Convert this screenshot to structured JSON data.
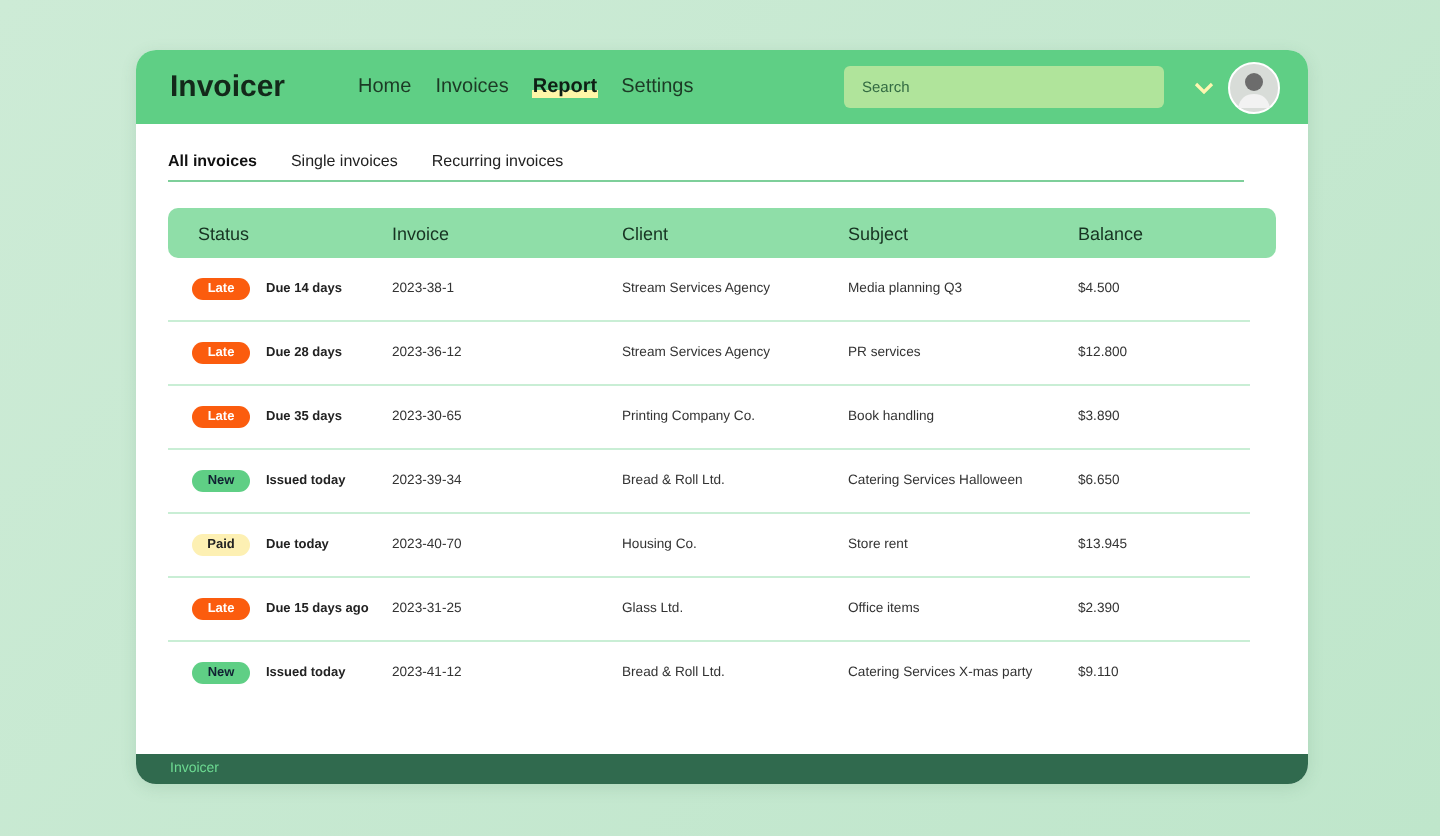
{
  "header": {
    "logo": "Invoicer",
    "nav": [
      {
        "label": "Home",
        "selected": false
      },
      {
        "label": "Invoices",
        "selected": false
      },
      {
        "label": "Report",
        "selected": true
      },
      {
        "label": "Settings",
        "selected": false
      }
    ],
    "search": {
      "placeholder": "Search"
    }
  },
  "tabs": [
    {
      "label": "All invoices",
      "selected": true
    },
    {
      "label": "Single invoices",
      "selected": false
    },
    {
      "label": "Recurring invoices",
      "selected": false
    }
  ],
  "table": {
    "columns": [
      "Status",
      "Invoice",
      "Client",
      "Subject",
      "Balance"
    ],
    "rows": [
      {
        "status": {
          "kind": "late",
          "label": "Late"
        },
        "due": "Due 14 days",
        "invoice": "2023-38-1",
        "client": "Stream Services Agency",
        "subject": "Media planning Q3",
        "balance": "$4.500"
      },
      {
        "status": {
          "kind": "late",
          "label": "Late"
        },
        "due": "Due 28 days",
        "invoice": "2023-36-12",
        "client": "Stream Services Agency",
        "subject": "PR services",
        "balance": "$12.800"
      },
      {
        "status": {
          "kind": "late",
          "label": "Late"
        },
        "due": "Due 35 days",
        "invoice": "2023-30-65",
        "client": "Printing Company Co.",
        "subject": "Book handling",
        "balance": "$3.890"
      },
      {
        "status": {
          "kind": "new",
          "label": "New"
        },
        "due": "Issued today",
        "invoice": "2023-39-34",
        "client": "Bread & Roll Ltd.",
        "subject": "Catering Services Halloween",
        "balance": "$6.650"
      },
      {
        "status": {
          "kind": "paid",
          "label": "Paid"
        },
        "due": "Due today",
        "invoice": "2023-40-70",
        "client": "Housing Co.",
        "subject": "Store rent",
        "balance": "$13.945"
      },
      {
        "status": {
          "kind": "late",
          "label": "Late"
        },
        "due": "Due 15 days ago",
        "invoice": "2023-31-25",
        "client": "Glass Ltd.",
        "subject": "Office items",
        "balance": "$2.390"
      },
      {
        "status": {
          "kind": "new",
          "label": "New"
        },
        "due": "Issued today",
        "invoice": "2023-41-12",
        "client": "Bread & Roll Ltd.",
        "subject": "Catering Services X-mas party",
        "balance": "$9.110"
      }
    ]
  },
  "footer": {
    "logo": "Invoicer"
  }
}
